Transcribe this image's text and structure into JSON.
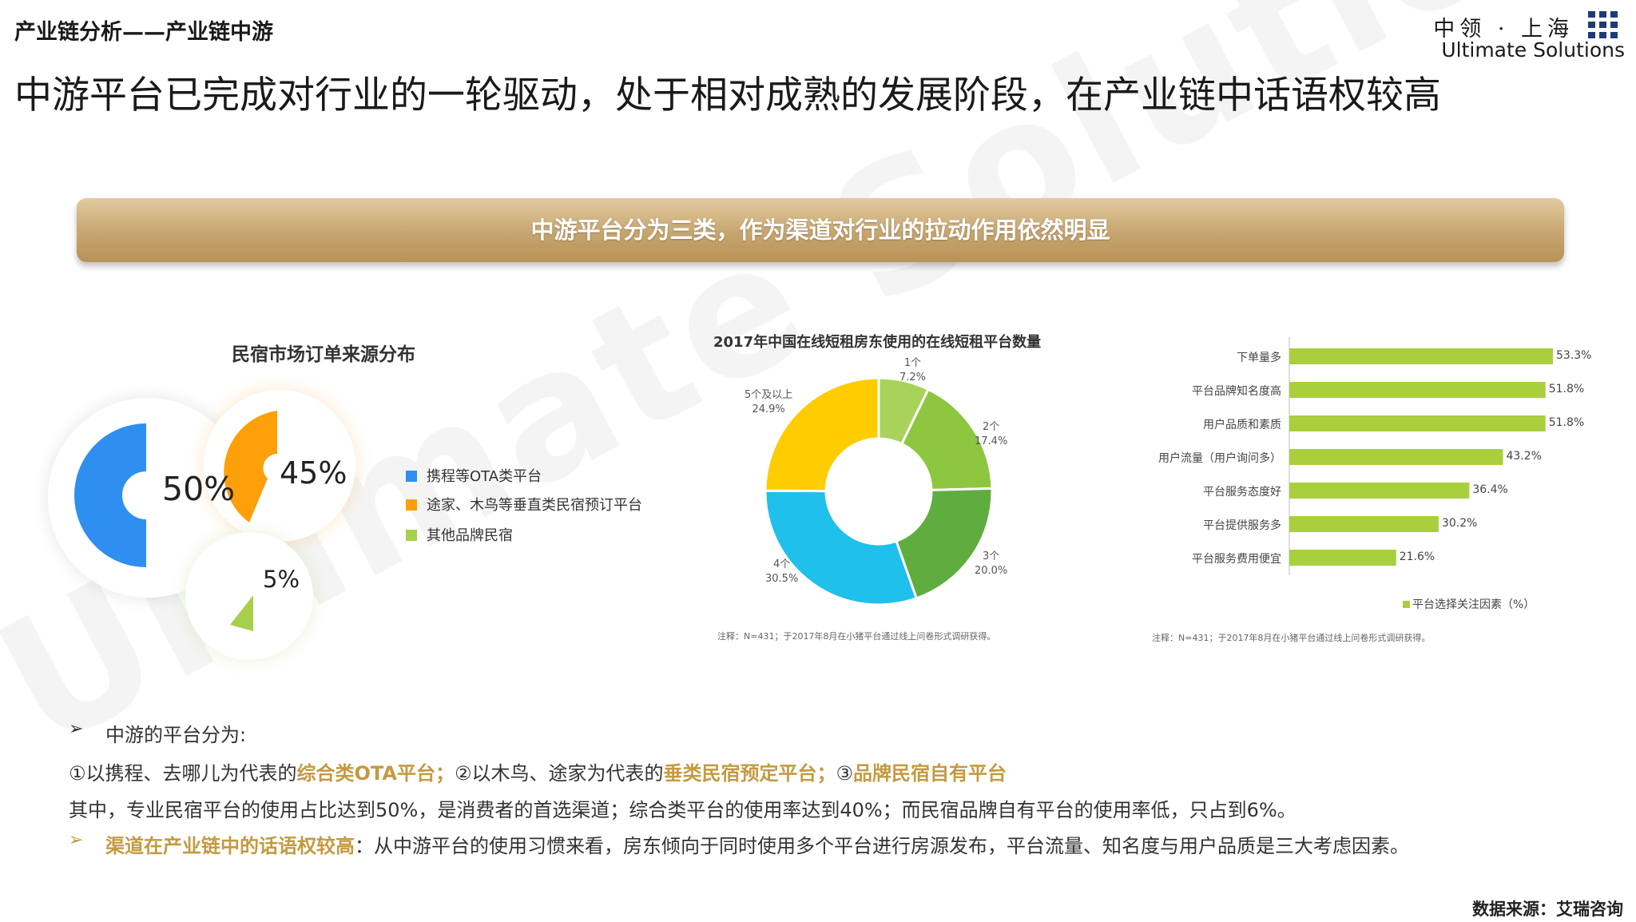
{
  "header": {
    "section": "产业链分析——产业链中游",
    "headline": "中游平台已完成对行业的一轮驱动，处于相对成熟的发展阶段，在产业链中话语权较高",
    "logo_cn": "中领 · 上海",
    "logo_en": "Ultimate Solutions",
    "watermark": "Ultimate Solutions"
  },
  "banner": {
    "text": "中游平台分为三类，作为渠道对行业的拉动作用依然明显"
  },
  "colors": {
    "blue": "#2f8ff0",
    "orange": "#ff9f0a",
    "green": "#a8cf4c",
    "gold": "#c49a40",
    "bar": "#a9cf3c"
  },
  "chart_data": [
    {
      "type": "pie",
      "title": "民宿市场订单来源分布",
      "series": [
        {
          "name": "携程等OTA类平台",
          "value": 50,
          "label": "50%"
        },
        {
          "name": "途家、木鸟等垂直类民宿预订平台",
          "value": 45,
          "label": "45%"
        },
        {
          "name": "其他品牌民宿",
          "value": 5,
          "label": "5%"
        }
      ]
    },
    {
      "type": "pie",
      "title": "2017年中国在线短租房东使用的在线短租平台数量",
      "slices": [
        {
          "label": "1个",
          "value": 7.2,
          "value_label": "7.2%",
          "color": "#a8d35a"
        },
        {
          "label": "2个",
          "value": 17.4,
          "value_label": "17.4%",
          "color": "#8dc63f"
        },
        {
          "label": "3个",
          "value": 20.0,
          "value_label": "20.0%",
          "color": "#5fad3f"
        },
        {
          "label": "4个",
          "value": 30.5,
          "value_label": "30.5%",
          "color": "#1fc0ec"
        },
        {
          "label": "5个及以上",
          "value": 24.9,
          "value_label": "24.9%",
          "color": "#ffcc00"
        }
      ],
      "note": "注释：N=431；于2017年8月在小猪平台通过线上问卷形式调研获得。"
    },
    {
      "type": "bar",
      "orientation": "horizontal",
      "categories": [
        "下单量多",
        "平台品牌知名度高",
        "用户品质和素质",
        "用户流量（用户询问多）",
        "平台服务态度好",
        "平台提供服务多",
        "平台服务费用便宜"
      ],
      "values": [
        53.3,
        51.8,
        51.8,
        43.2,
        36.4,
        30.2,
        21.6
      ],
      "value_labels": [
        "53.3%",
        "51.8%",
        "51.8%",
        "43.2%",
        "36.4%",
        "30.2%",
        "21.6%"
      ],
      "legend": "平台选择关注因素（%）",
      "note": "注释：N=431；于2017年8月在小猪平台通过线上问卷形式调研获得。"
    }
  ],
  "body_text": {
    "bullet1": "中游的平台分为:",
    "line2": {
      "p1": "①以携程、去哪儿为代表的",
      "h1": "综合类OTA平台；",
      "p2": "②以木鸟、途家为代表的",
      "h2": "垂类民宿预定平台；",
      "p3": "③",
      "h3": "品牌民宿自有平台"
    },
    "line3": "其中，专业民宿平台的使用占比达到50%，是消费者的首选渠道；综合类平台的使用率达到40%；而民宿品牌自有平台的使用率低，只占到6%。",
    "line4": {
      "h": "渠道在产业链中的话语权较高",
      "p": "：从中游平台的使用习惯来看，房东倾向于同时使用多个平台进行房源发布，平台流量、知名度与用户品质是三大考虑因素。"
    }
  },
  "footer": {
    "source": "数据来源：艾瑞咨询"
  }
}
